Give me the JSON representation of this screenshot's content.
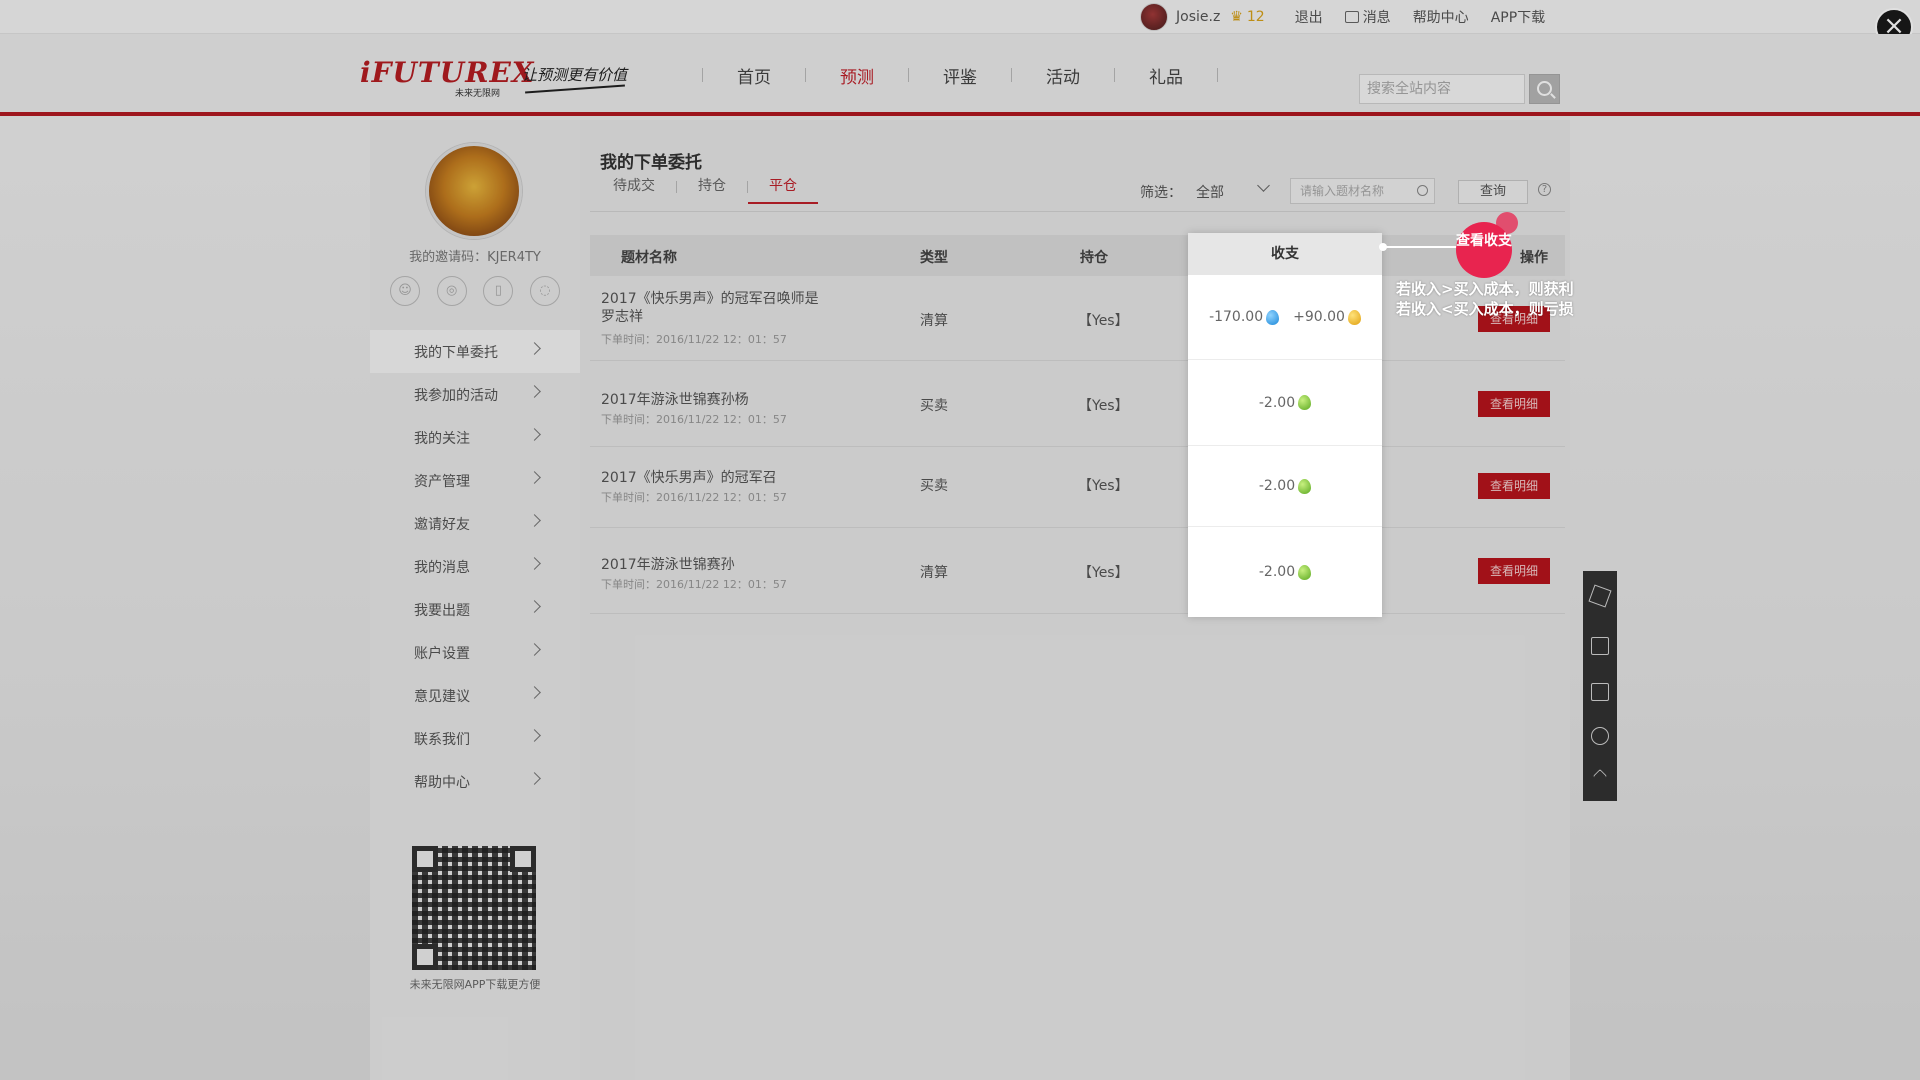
{
  "topbar": {
    "username": "Josie.z",
    "level": "12",
    "logout": "退出",
    "messages": "消息",
    "help_center": "帮助中心",
    "app_download": "APP下载"
  },
  "header": {
    "logo_text": "iFUTUREX",
    "logo_sub": "未来无限网",
    "slogan": "让预测更有价值",
    "nav": [
      "首页",
      "预测",
      "评鉴",
      "活动",
      "礼品"
    ],
    "nav_active": "预测",
    "search_placeholder": "搜索全站内容"
  },
  "sidebar": {
    "invite_code": "我的邀请码：KJER4TY",
    "menu": [
      "我的下单委托",
      "我参加的活动",
      "我的关注",
      "资产管理",
      "邀请好友",
      "我的消息",
      "我要出题",
      "账户设置",
      "意见建议",
      "联系我们",
      "帮助中心"
    ],
    "qr_caption": "未来无限网APP下载更方便"
  },
  "main": {
    "title": "我的下单委托",
    "tabs": [
      "待成交",
      "持仓",
      "平仓"
    ],
    "active_tab": "平仓",
    "filter_label": "筛选：",
    "filter_value": "全部",
    "search_placeholder": "请输入题材名称",
    "query_button": "查询",
    "help": "?",
    "columns": {
      "name": "题材名称",
      "type": "类型",
      "position": "持仓",
      "income": "收支",
      "action": "操作"
    },
    "rows": [
      {
        "name": "2017《快乐男声》的冠军召唤师是罗志祥",
        "time": "下单时间：2016/11/22  12：01：57",
        "type": "清算",
        "position": "【Yes】",
        "income_neg": "-170.00",
        "income_pos": "+90.00",
        "action": "查看明细"
      },
      {
        "name": "2017年游泳世锦赛孙杨",
        "time": "下单时间：2016/11/22  12：01：57",
        "type": "买卖",
        "position": "【Yes】",
        "income": "-2.00",
        "action": "查看明细"
      },
      {
        "name": "2017《快乐男声》的冠军召",
        "time": "下单时间：2016/11/22  12：01：57",
        "type": "买卖",
        "position": "【Yes】",
        "income": "-2.00",
        "action": "查看明细"
      },
      {
        "name": "2017年游泳世锦赛孙",
        "time": "下单时间：2016/11/22  12：01：57",
        "type": "清算",
        "position": "【Yes】",
        "income": "-2.00",
        "action": "查看明细"
      }
    ]
  },
  "callout": {
    "bubble": "查看收支",
    "line1": "若收入>买入成本，则获利",
    "line2": "若收入<买入成本，则亏损"
  },
  "colors": {
    "brand": "#b41a22",
    "accent": "#c0202a",
    "callout": "#e8244f"
  }
}
